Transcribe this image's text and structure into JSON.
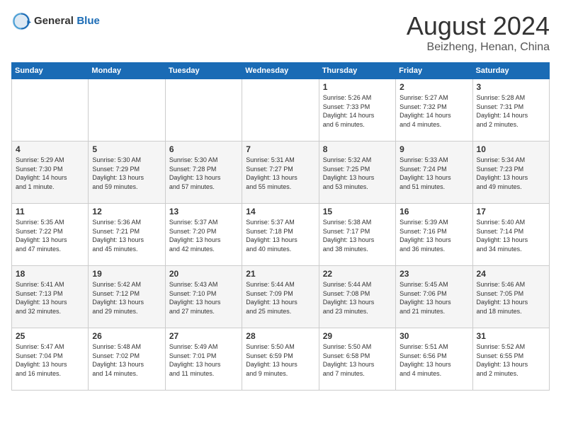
{
  "header": {
    "logo_general": "General",
    "logo_blue": "Blue",
    "month_title": "August 2024",
    "location": "Beizheng, Henan, China"
  },
  "days_of_week": [
    "Sunday",
    "Monday",
    "Tuesday",
    "Wednesday",
    "Thursday",
    "Friday",
    "Saturday"
  ],
  "weeks": [
    {
      "cells": [
        {
          "day": "",
          "info": ""
        },
        {
          "day": "",
          "info": ""
        },
        {
          "day": "",
          "info": ""
        },
        {
          "day": "",
          "info": ""
        },
        {
          "day": "1",
          "info": "Sunrise: 5:26 AM\nSunset: 7:33 PM\nDaylight: 14 hours\nand 6 minutes."
        },
        {
          "day": "2",
          "info": "Sunrise: 5:27 AM\nSunset: 7:32 PM\nDaylight: 14 hours\nand 4 minutes."
        },
        {
          "day": "3",
          "info": "Sunrise: 5:28 AM\nSunset: 7:31 PM\nDaylight: 14 hours\nand 2 minutes."
        }
      ]
    },
    {
      "cells": [
        {
          "day": "4",
          "info": "Sunrise: 5:29 AM\nSunset: 7:30 PM\nDaylight: 14 hours\nand 1 minute."
        },
        {
          "day": "5",
          "info": "Sunrise: 5:30 AM\nSunset: 7:29 PM\nDaylight: 13 hours\nand 59 minutes."
        },
        {
          "day": "6",
          "info": "Sunrise: 5:30 AM\nSunset: 7:28 PM\nDaylight: 13 hours\nand 57 minutes."
        },
        {
          "day": "7",
          "info": "Sunrise: 5:31 AM\nSunset: 7:27 PM\nDaylight: 13 hours\nand 55 minutes."
        },
        {
          "day": "8",
          "info": "Sunrise: 5:32 AM\nSunset: 7:25 PM\nDaylight: 13 hours\nand 53 minutes."
        },
        {
          "day": "9",
          "info": "Sunrise: 5:33 AM\nSunset: 7:24 PM\nDaylight: 13 hours\nand 51 minutes."
        },
        {
          "day": "10",
          "info": "Sunrise: 5:34 AM\nSunset: 7:23 PM\nDaylight: 13 hours\nand 49 minutes."
        }
      ]
    },
    {
      "cells": [
        {
          "day": "11",
          "info": "Sunrise: 5:35 AM\nSunset: 7:22 PM\nDaylight: 13 hours\nand 47 minutes."
        },
        {
          "day": "12",
          "info": "Sunrise: 5:36 AM\nSunset: 7:21 PM\nDaylight: 13 hours\nand 45 minutes."
        },
        {
          "day": "13",
          "info": "Sunrise: 5:37 AM\nSunset: 7:20 PM\nDaylight: 13 hours\nand 42 minutes."
        },
        {
          "day": "14",
          "info": "Sunrise: 5:37 AM\nSunset: 7:18 PM\nDaylight: 13 hours\nand 40 minutes."
        },
        {
          "day": "15",
          "info": "Sunrise: 5:38 AM\nSunset: 7:17 PM\nDaylight: 13 hours\nand 38 minutes."
        },
        {
          "day": "16",
          "info": "Sunrise: 5:39 AM\nSunset: 7:16 PM\nDaylight: 13 hours\nand 36 minutes."
        },
        {
          "day": "17",
          "info": "Sunrise: 5:40 AM\nSunset: 7:14 PM\nDaylight: 13 hours\nand 34 minutes."
        }
      ]
    },
    {
      "cells": [
        {
          "day": "18",
          "info": "Sunrise: 5:41 AM\nSunset: 7:13 PM\nDaylight: 13 hours\nand 32 minutes."
        },
        {
          "day": "19",
          "info": "Sunrise: 5:42 AM\nSunset: 7:12 PM\nDaylight: 13 hours\nand 29 minutes."
        },
        {
          "day": "20",
          "info": "Sunrise: 5:43 AM\nSunset: 7:10 PM\nDaylight: 13 hours\nand 27 minutes."
        },
        {
          "day": "21",
          "info": "Sunrise: 5:44 AM\nSunset: 7:09 PM\nDaylight: 13 hours\nand 25 minutes."
        },
        {
          "day": "22",
          "info": "Sunrise: 5:44 AM\nSunset: 7:08 PM\nDaylight: 13 hours\nand 23 minutes."
        },
        {
          "day": "23",
          "info": "Sunrise: 5:45 AM\nSunset: 7:06 PM\nDaylight: 13 hours\nand 21 minutes."
        },
        {
          "day": "24",
          "info": "Sunrise: 5:46 AM\nSunset: 7:05 PM\nDaylight: 13 hours\nand 18 minutes."
        }
      ]
    },
    {
      "cells": [
        {
          "day": "25",
          "info": "Sunrise: 5:47 AM\nSunset: 7:04 PM\nDaylight: 13 hours\nand 16 minutes."
        },
        {
          "day": "26",
          "info": "Sunrise: 5:48 AM\nSunset: 7:02 PM\nDaylight: 13 hours\nand 14 minutes."
        },
        {
          "day": "27",
          "info": "Sunrise: 5:49 AM\nSunset: 7:01 PM\nDaylight: 13 hours\nand 11 minutes."
        },
        {
          "day": "28",
          "info": "Sunrise: 5:50 AM\nSunset: 6:59 PM\nDaylight: 13 hours\nand 9 minutes."
        },
        {
          "day": "29",
          "info": "Sunrise: 5:50 AM\nSunset: 6:58 PM\nDaylight: 13 hours\nand 7 minutes."
        },
        {
          "day": "30",
          "info": "Sunrise: 5:51 AM\nSunset: 6:56 PM\nDaylight: 13 hours\nand 4 minutes."
        },
        {
          "day": "31",
          "info": "Sunrise: 5:52 AM\nSunset: 6:55 PM\nDaylight: 13 hours\nand 2 minutes."
        }
      ]
    }
  ]
}
